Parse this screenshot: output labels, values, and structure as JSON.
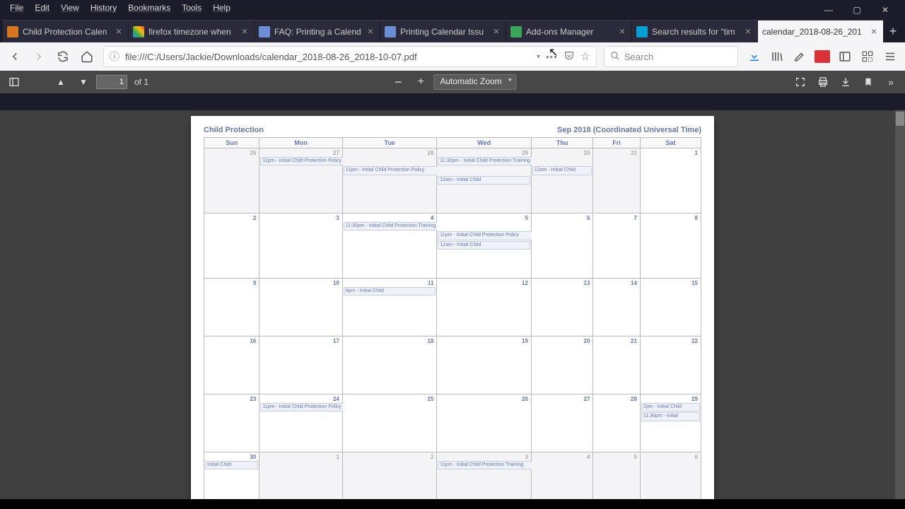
{
  "menu": [
    "File",
    "Edit",
    "View",
    "History",
    "Bookmarks",
    "Tools",
    "Help"
  ],
  "win": {
    "min": "—",
    "max": "▢",
    "close": "✕"
  },
  "tabs": [
    {
      "label": "Child Protection Calen",
      "fav": "#d97720"
    },
    {
      "label": "firefox timezone when",
      "fav": "#4285f4"
    },
    {
      "label": "FAQ: Printing a Calend",
      "fav": "#6b8fd6"
    },
    {
      "label": "Printing Calendar Issu",
      "fav": "#6b8fd6"
    },
    {
      "label": "Add-ons Manager",
      "fav": "#3aa757"
    },
    {
      "label": "Search results for \"tim",
      "fav": "#00a0d2"
    },
    {
      "label": "calendar_2018-08-26_201",
      "fav": "",
      "active": true
    }
  ],
  "newtab": "+",
  "url": "file:///C:/Users/Jackie/Downloads/calendar_2018-08-26_2018-10-07.pdf",
  "search_placeholder": "Search",
  "pdf": {
    "page": "1",
    "of": "of 1",
    "zoom": "Automatic Zoom"
  },
  "cal": {
    "title": "Child Protection",
    "month": "Sep 2018 (Coordinated Universal Time)",
    "days": [
      "Sun",
      "Mon",
      "Tue",
      "Wed",
      "Thu",
      "Fri",
      "Sat"
    ]
  },
  "ev": {
    "e1": "11pm - Initial Child Protection Policy",
    "e2": "11:30pm - Initial Child Protection Training",
    "e3": "11pm - Initial Child Protection Policy",
    "e4": "12am - Initial Child",
    "e5": "12am - Initial Child",
    "e6": "11:30pm - Initial Child Protection Training",
    "e7": "11pm - Initial Child Protection Policy",
    "e8": "12am - Initial Child",
    "e9": "6pm - Initial Child",
    "e10": "11pm - Initial Child Protection Policy",
    "e11": "2pm - Initial Child",
    "e12": "11:30pm - Initial",
    "e13": "Initial Child",
    "e14": "11pm - Initial Child Protection Training"
  },
  "nums": {
    "r1": [
      "26",
      "27",
      "28",
      "29",
      "30",
      "31",
      "1"
    ],
    "r2": [
      "2",
      "3",
      "4",
      "5",
      "6",
      "7",
      "8"
    ],
    "r3": [
      "9",
      "10",
      "11",
      "12",
      "13",
      "14",
      "15"
    ],
    "r4": [
      "16",
      "17",
      "18",
      "19",
      "20",
      "21",
      "22"
    ],
    "r5": [
      "23",
      "24",
      "25",
      "26",
      "27",
      "28",
      "29"
    ],
    "r6": [
      "30",
      "1",
      "2",
      "3",
      "4",
      "5",
      "6"
    ]
  }
}
